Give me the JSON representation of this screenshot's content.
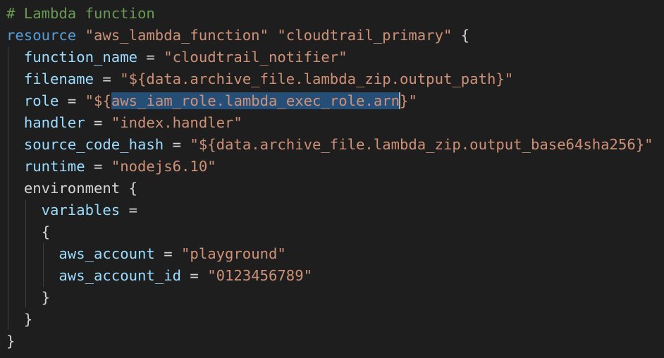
{
  "code": {
    "comment": "# Lambda function",
    "resource_kw": "resource",
    "resource_type": "\"aws_lambda_function\"",
    "resource_name": "\"cloudtrail_primary\"",
    "open_brace": "{",
    "close_brace": "}",
    "eq": "=",
    "function_name_key": "function_name",
    "function_name_val": "\"cloudtrail_notifier\"",
    "filename_key": "filename",
    "filename_val": "\"${data.archive_file.lambda_zip.output_path}\"",
    "role_key": "role",
    "role_prefix": "\"${",
    "role_seg1": "aws_iam_role",
    "role_dot1": ".",
    "role_seg2": "lambda_exec_role",
    "role_dot2": ".",
    "role_seg3": "arn",
    "role_suffix_brace": "}",
    "role_suffix_quote": "\"",
    "handler_key": "handler",
    "handler_val": "\"index.handler\"",
    "hash_key": "source_code_hash",
    "hash_val": "\"${data.archive_file.lambda_zip.output_base64sha256}\"",
    "runtime_key": "runtime",
    "runtime_val": "\"nodejs6.10\"",
    "environment_key": "environment",
    "variables_key": "variables",
    "aws_account_key": "aws_account",
    "aws_account_val": "\"playground\"",
    "aws_account_id_key": "aws_account_id",
    "aws_account_id_val": "\"0123456789\""
  },
  "colors": {
    "background": "#1e1e1e",
    "comment": "#6a9955",
    "keyword": "#569cd6",
    "string": "#ce9178",
    "identifier": "#9cdcfe",
    "selection": "#264f78",
    "dot_highlight": "#c586c0"
  }
}
